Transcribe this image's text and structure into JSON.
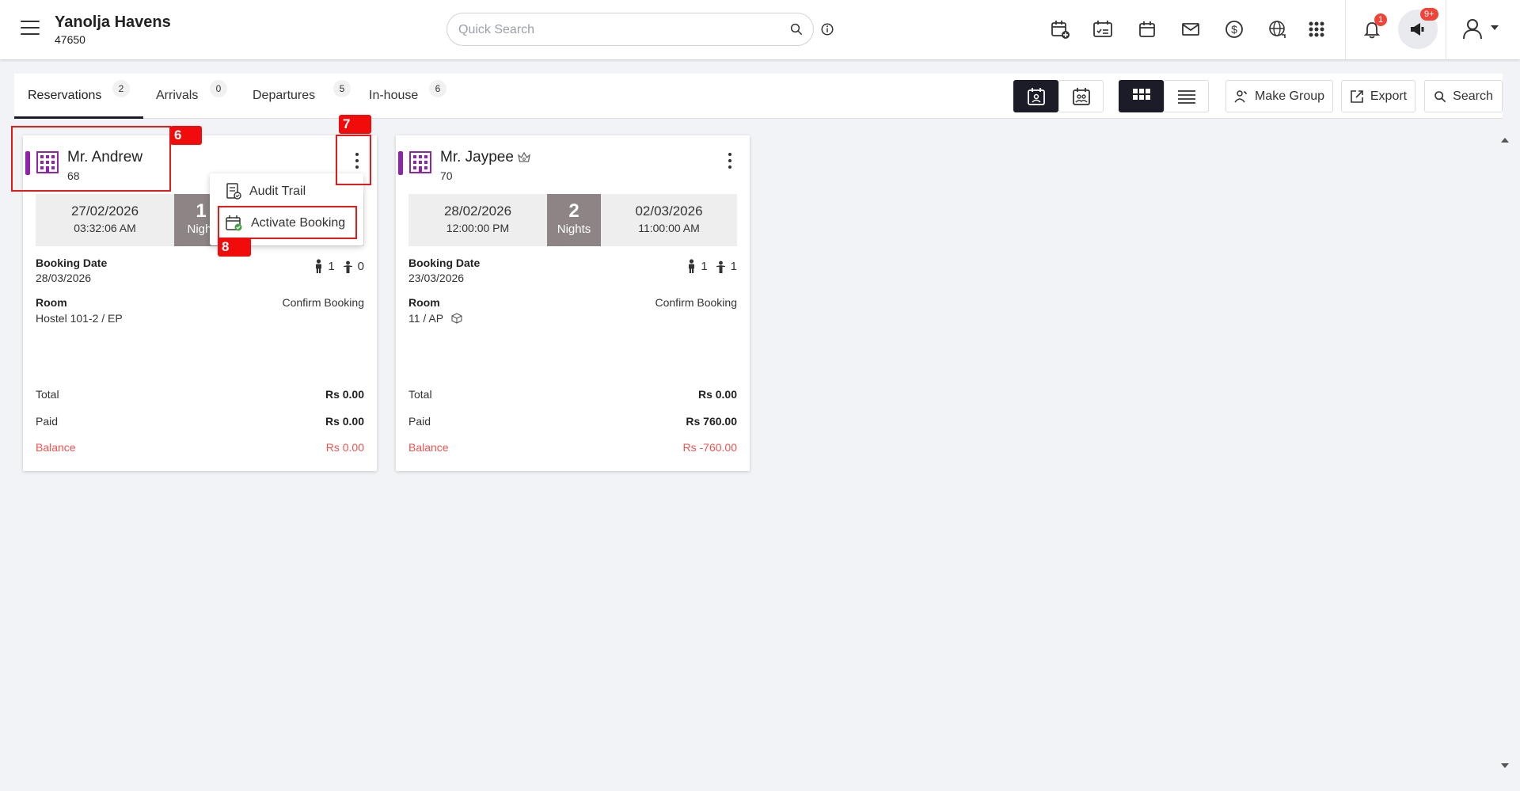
{
  "header": {
    "hotel_name": "Yanolja Havens",
    "hotel_id": "47650",
    "search_placeholder": "Quick Search",
    "notifications_count": "1",
    "announcements_count": "9+"
  },
  "tabs": [
    {
      "label": "Reservations",
      "count": "2"
    },
    {
      "label": "Arrivals",
      "count": "0"
    },
    {
      "label": "Departures",
      "count": "5"
    },
    {
      "label": "In-house",
      "count": "6"
    }
  ],
  "toolbar": {
    "make_group_label": "Make Group",
    "export_label": "Export",
    "search_label": "Search"
  },
  "cards": [
    {
      "guest_name": "Mr. Andrew",
      "booking_number": "68",
      "arrival_date": "27/02/2026",
      "arrival_time": "03:32:06 AM",
      "nights_count": "1",
      "nights_label": "Night",
      "departure_date": "",
      "departure_time": "",
      "booking_date_label": "Booking Date",
      "booking_date": "28/03/2026",
      "adults": "1",
      "children": "0",
      "room_label": "Room",
      "room_value": "Hostel 101-2 / EP",
      "status": "Confirm Booking",
      "total_label": "Total",
      "total_value": "Rs 0.00",
      "paid_label": "Paid",
      "paid_value": "Rs 0.00",
      "balance_label": "Balance",
      "balance_value": "Rs 0.00"
    },
    {
      "guest_name": "Mr. Jaypee",
      "booking_number": "70",
      "arrival_date": "28/02/2026",
      "arrival_time": "12:00:00 PM",
      "nights_count": "2",
      "nights_label": "Nights",
      "departure_date": "02/03/2026",
      "departure_time": "11:00:00 AM",
      "booking_date_label": "Booking Date",
      "booking_date": "23/03/2026",
      "adults": "1",
      "children": "1",
      "room_label": "Room",
      "room_value": "11 / AP",
      "status": "Confirm Booking",
      "total_label": "Total",
      "total_value": "Rs 0.00",
      "paid_label": "Paid",
      "paid_value": "Rs 760.00",
      "balance_label": "Balance",
      "balance_value": "Rs -760.00"
    }
  ],
  "context_menu": {
    "items": [
      {
        "label": "Audit Trail",
        "icon": "audit-trail-icon"
      },
      {
        "label": "Activate Booking",
        "icon": "calendar-check-icon"
      }
    ]
  },
  "annotations": [
    "6",
    "7",
    "8"
  ],
  "colors": {
    "accent_dark": "#1c1c28",
    "stripe": "#8e24aa",
    "nights_bg": "#8d8585",
    "balance_red": "#ef5350",
    "annotation_red": "#f20b0b"
  }
}
